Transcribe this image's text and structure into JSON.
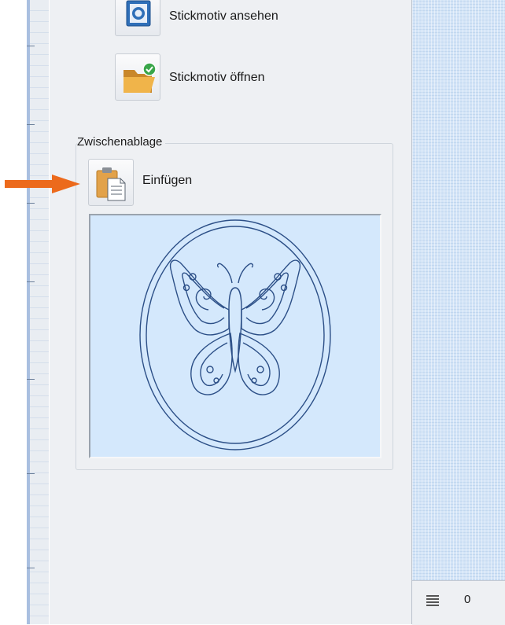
{
  "actions": {
    "view_label": "Stickmotiv ansehen",
    "open_label": "Stickmotiv öffnen"
  },
  "clipboard": {
    "title": "Zwischenablage",
    "paste_label": "Einfügen"
  },
  "status": {
    "value": "0"
  },
  "icons": {
    "view": "view-embroidery-icon",
    "open": "open-folder-icon",
    "paste": "paste-clipboard-icon",
    "status": "stitch-list-icon"
  },
  "colors": {
    "arrow": "#ec6a1c",
    "preview_background": "#d4e8fc",
    "stitch_line": "#2c4f87"
  }
}
